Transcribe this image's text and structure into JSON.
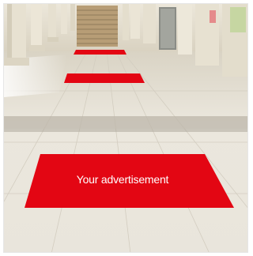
{
  "scene": {
    "colors": {
      "floor_light": "#eeeae1",
      "floor_mid": "#e3dfd5",
      "floor_dark": "#cfc9bd",
      "wall": "#e9e4d6",
      "pillar": "#e7e1d1",
      "shadow": "#cfc6b2",
      "window_light": "#fbfaf5",
      "stairs": "#b79d76",
      "stairs_dark": "#8f7a5a",
      "ad_red": "#e30613",
      "ad_text": "#ffffff",
      "border_band": "#bcb6aa"
    }
  },
  "floor_ads": {
    "main_label": "Your advertisement"
  }
}
